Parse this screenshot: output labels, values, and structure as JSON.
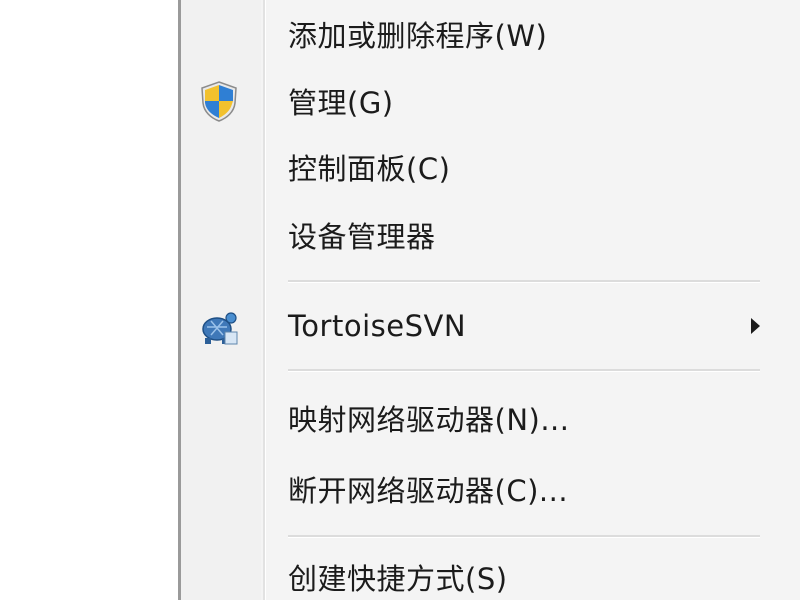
{
  "menu": {
    "items": [
      {
        "label": "添加或删除程序(W)",
        "icon": ""
      },
      {
        "label": "管理(G)",
        "icon": "shield-icon"
      },
      {
        "label": "控制面板(C)",
        "icon": ""
      },
      {
        "label": "设备管理器",
        "icon": ""
      },
      {
        "label": "TortoiseSVN",
        "icon": "tortoise-icon",
        "submenu": true
      },
      {
        "label": "映射网络驱动器(N)...",
        "icon": ""
      },
      {
        "label": "断开网络驱动器(C)...",
        "icon": ""
      },
      {
        "label": "创建快捷方式(S)",
        "icon": ""
      }
    ]
  },
  "colors": {
    "menu_bg": "#f4f4f4",
    "text": "#1b1b1b",
    "separator": "#dcdcdc"
  }
}
